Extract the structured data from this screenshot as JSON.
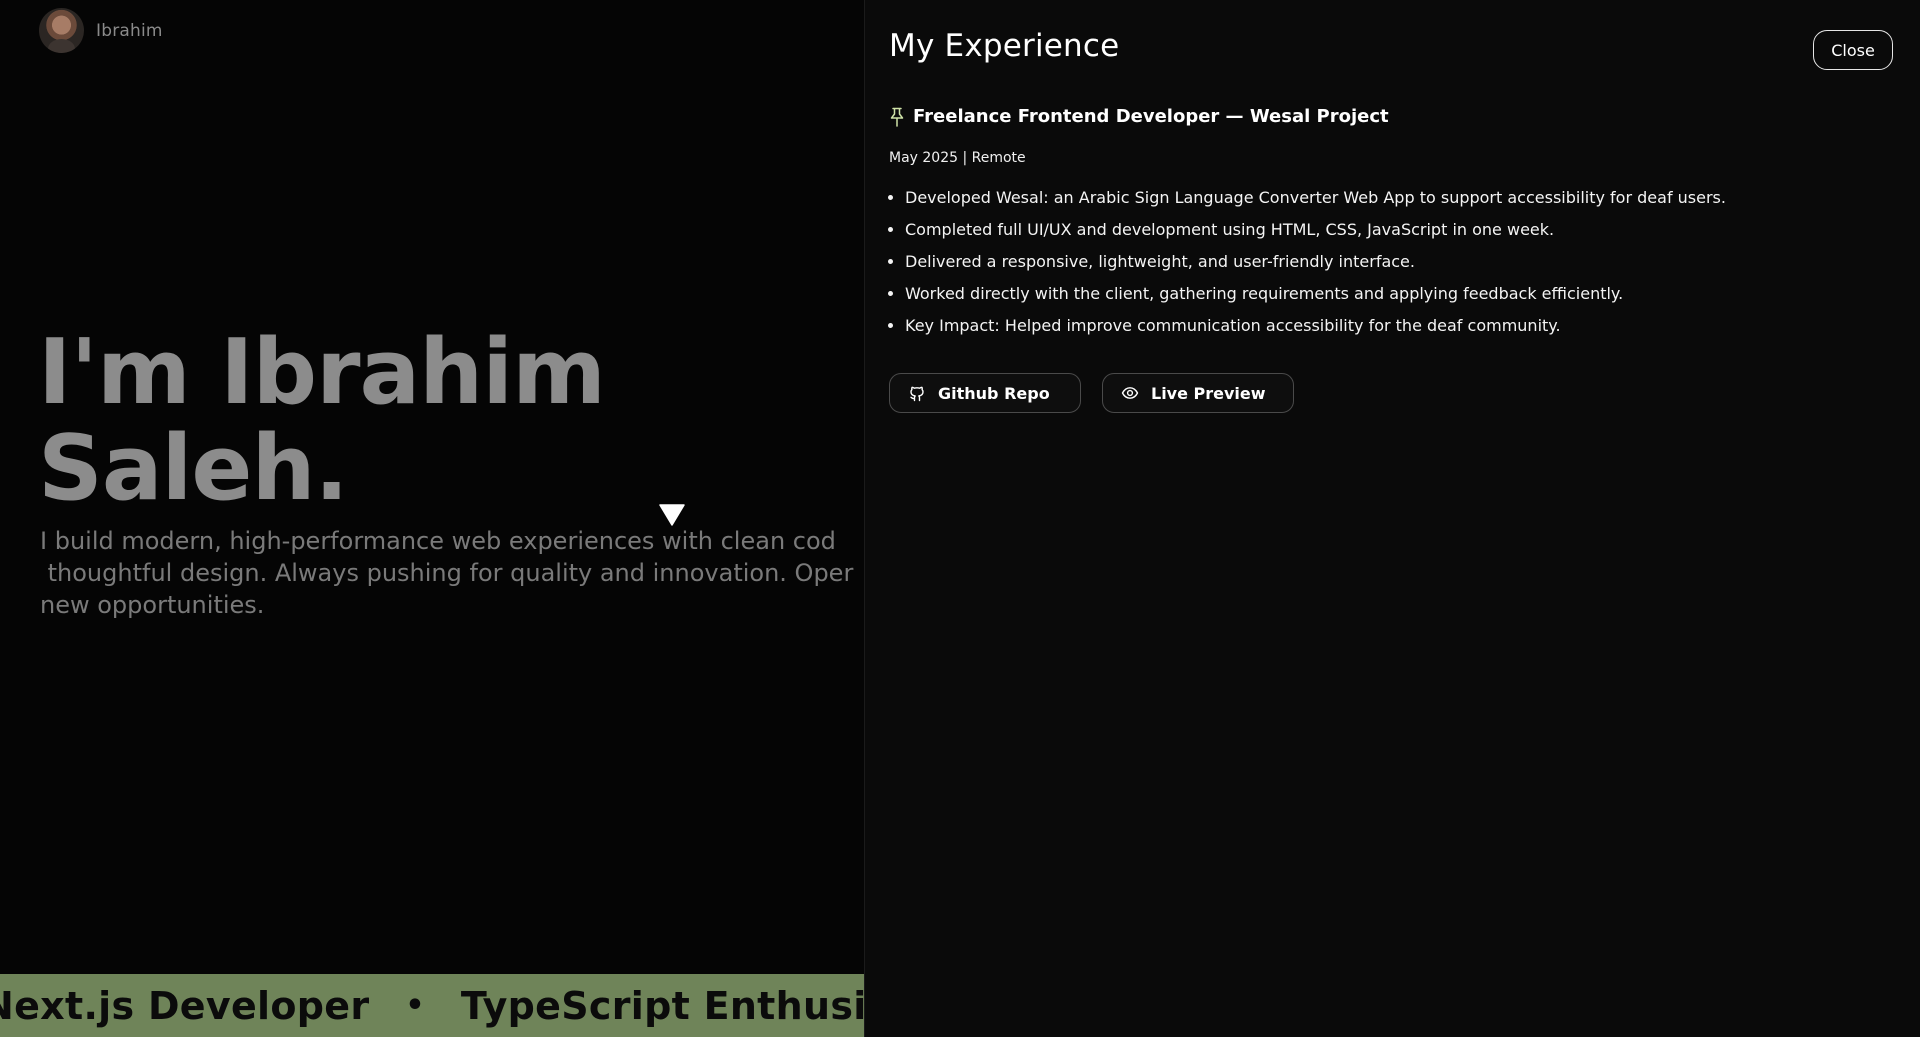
{
  "header": {
    "brand_name": "Ibrahim"
  },
  "hero": {
    "title_line1": "I'm Ibrahim",
    "title_line2": "Saleh.",
    "subtitle_line1": "I build modern, high-performance web experiences with clean cod",
    "subtitle_line2": " thoughtful design. Always pushing for quality and innovation. Oper",
    "subtitle_line3": "new opportunities."
  },
  "marquee": {
    "items": [
      "Next.js Developer",
      "TypeScript Enthusiast"
    ],
    "separator": "•",
    "background_color": "#6f8459"
  },
  "experience_panel": {
    "title": "My Experience",
    "close_label": "Close",
    "job": {
      "title": "Freelance Frontend Developer — Wesal Project",
      "meta": "May 2025 | Remote",
      "bullets": [
        "Developed Wesal: an Arabic Sign Language Converter Web App to support accessibility for deaf users.",
        "Completed full UI/UX and development using HTML, CSS, JavaScript in one week.",
        "Delivered a responsive, lightweight, and user-friendly interface.",
        "Worked directly with the client, gathering requirements and applying feedback efficiently.",
        "Key Impact: Helped improve communication accessibility for the deaf community."
      ],
      "buttons": {
        "github_label": "Github Repo",
        "github_icon": "github-icon",
        "preview_label": "Live Preview",
        "preview_icon": "eye-icon"
      }
    }
  }
}
